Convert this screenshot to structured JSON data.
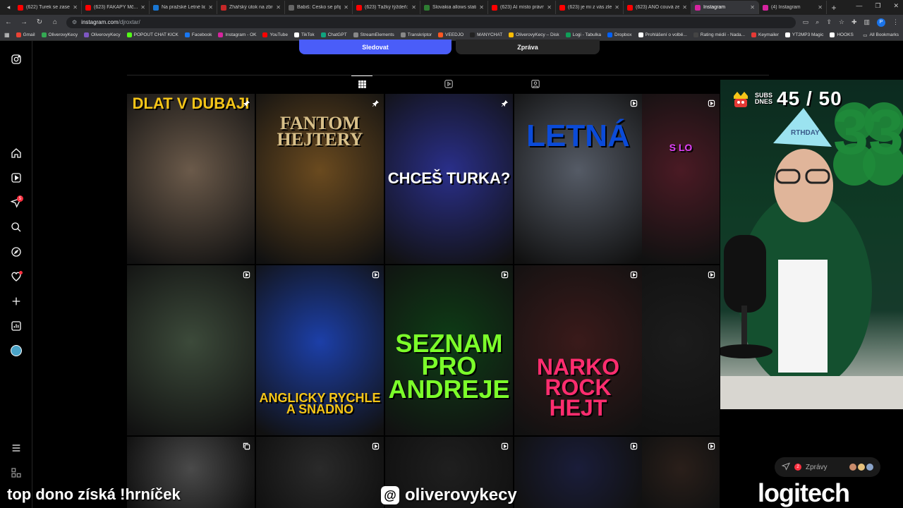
{
  "browser": {
    "tabs": [
      {
        "title": "(622) Turek se zase ze...",
        "favicon_color": "#ff0000"
      },
      {
        "title": "(623) FAKAPY Mč...",
        "favicon_color": "#ff0000"
      },
      {
        "title": "Na pražské Letné lid...",
        "favicon_color": "#1976d2"
      },
      {
        "title": "Žhářský útok na zbroj...",
        "favicon_color": "#c62828"
      },
      {
        "title": "Babiš: Česko se připoj...",
        "favicon_color": "#666666"
      },
      {
        "title": "(623) Ťažký týždeň: O...",
        "favicon_color": "#ff0000"
      },
      {
        "title": "Slovakia allows station...",
        "favicon_color": "#2e7d32"
      },
      {
        "title": "(623) AI místo právníků...",
        "favicon_color": "#ff0000"
      },
      {
        "title": "(623) je mi z vás zle -...",
        "favicon_color": "#ff0000"
      },
      {
        "title": "(623) ANO couvá ze z...",
        "favicon_color": "#ff0000"
      },
      {
        "title": "Instagram",
        "favicon_color": "#d6249f",
        "active": true
      },
      {
        "title": "(4) Instagram",
        "favicon_color": "#d6249f"
      }
    ],
    "url_host": "instagram.com",
    "url_path": "/djroxtar/",
    "profile_initial": "P",
    "bookmarks": [
      {
        "label": "Gmail",
        "color": "#ea4335"
      },
      {
        "label": "OliverovyKecy",
        "color": "#34a853"
      },
      {
        "label": "OliverovyKecy",
        "color": "#7e57c2"
      },
      {
        "label": "POPOUT CHAT KICK",
        "color": "#53fc18"
      },
      {
        "label": "Facebook",
        "color": "#1877f2"
      },
      {
        "label": "Instagram - OK",
        "color": "#d6249f"
      },
      {
        "label": "YouTube",
        "color": "#ff0000"
      },
      {
        "label": "TikTok",
        "color": "#ffffff"
      },
      {
        "label": "ChatGPT",
        "color": "#10a37f"
      },
      {
        "label": "StreamElements",
        "color": "#888888"
      },
      {
        "label": "Transkriptor",
        "color": "#888888"
      },
      {
        "label": "VEEDJO",
        "color": "#ff5722"
      },
      {
        "label": "MANYCHAT",
        "color": "#222222"
      },
      {
        "label": "OliverovyKecy – Disk",
        "color": "#fbbc04"
      },
      {
        "label": "Logi - Tabulka",
        "color": "#0f9d58"
      },
      {
        "label": "Dropbox",
        "color": "#0061ff"
      },
      {
        "label": "Prohlášení o volbě...",
        "color": "#ffffff"
      },
      {
        "label": "Rating médií - Nada...",
        "color": "#444444"
      },
      {
        "label": "Keymailer",
        "color": "#e53935"
      },
      {
        "label": "YT2MP3 Magic",
        "color": "#ffffff"
      },
      {
        "label": "HOOKS",
        "color": "#ffffff"
      }
    ],
    "all_bookmarks_label": "All Bookmarks"
  },
  "instagram": {
    "follow_label": "Sledovat",
    "message_label": "Zpráva",
    "notifications_count": "5",
    "messages_label": "Zprávy",
    "messages_count": "2",
    "accent": "#4a5df9",
    "posts": [
      {
        "text": "DLAT V DUBAJI",
        "type": "pinned",
        "bg": "#6b5a4a"
      },
      {
        "text": "FANTOM HEJTERY",
        "type": "pinned",
        "bg": "#6a4a1f"
      },
      {
        "text": "CHCEŠ TURKA?",
        "type": "pinned",
        "bg": "#2a2f8a"
      },
      {
        "text": "LETNÁ",
        "type": "reel",
        "bg": "#555b66"
      },
      {
        "text": "S LO",
        "type": "reel",
        "bg": "#4a1a24"
      },
      {
        "text": "",
        "type": "reel",
        "bg": "#3c4a3a"
      },
      {
        "text": "ANGLICKY RYCHLE A SNADNO",
        "type": "reel",
        "bg": "#1c3fa8"
      },
      {
        "text": "SEZNAM PRO ANDREJE",
        "type": "reel",
        "bg": "#0e3d16"
      },
      {
        "text": "NARKO ROCK HEJT",
        "type": "reel",
        "bg": "#3a1a1a"
      },
      {
        "text": "",
        "type": "reel",
        "bg": "#1c1c1c"
      },
      {
        "text": "",
        "type": "carousel",
        "bg": "#4a4a4a"
      },
      {
        "text": "",
        "type": "reel",
        "bg": "#2a2a2a"
      },
      {
        "text": "",
        "type": "reel",
        "bg": "#1f1f1f"
      },
      {
        "text": "",
        "type": "reel",
        "bg": "#1a1d3a"
      },
      {
        "text": "",
        "type": "reel",
        "bg": "#2a1f1a"
      }
    ]
  },
  "stream": {
    "subs_label_1": "SUBS",
    "subs_label_2": "DNES",
    "subs_count": "45 / 50",
    "balloon_number": "33",
    "party_hat_text": "RTHDAY",
    "bottom_left": "top dono získá !hrníček",
    "threads_handle": "oliverovykecy",
    "sponsor": "logitech"
  }
}
